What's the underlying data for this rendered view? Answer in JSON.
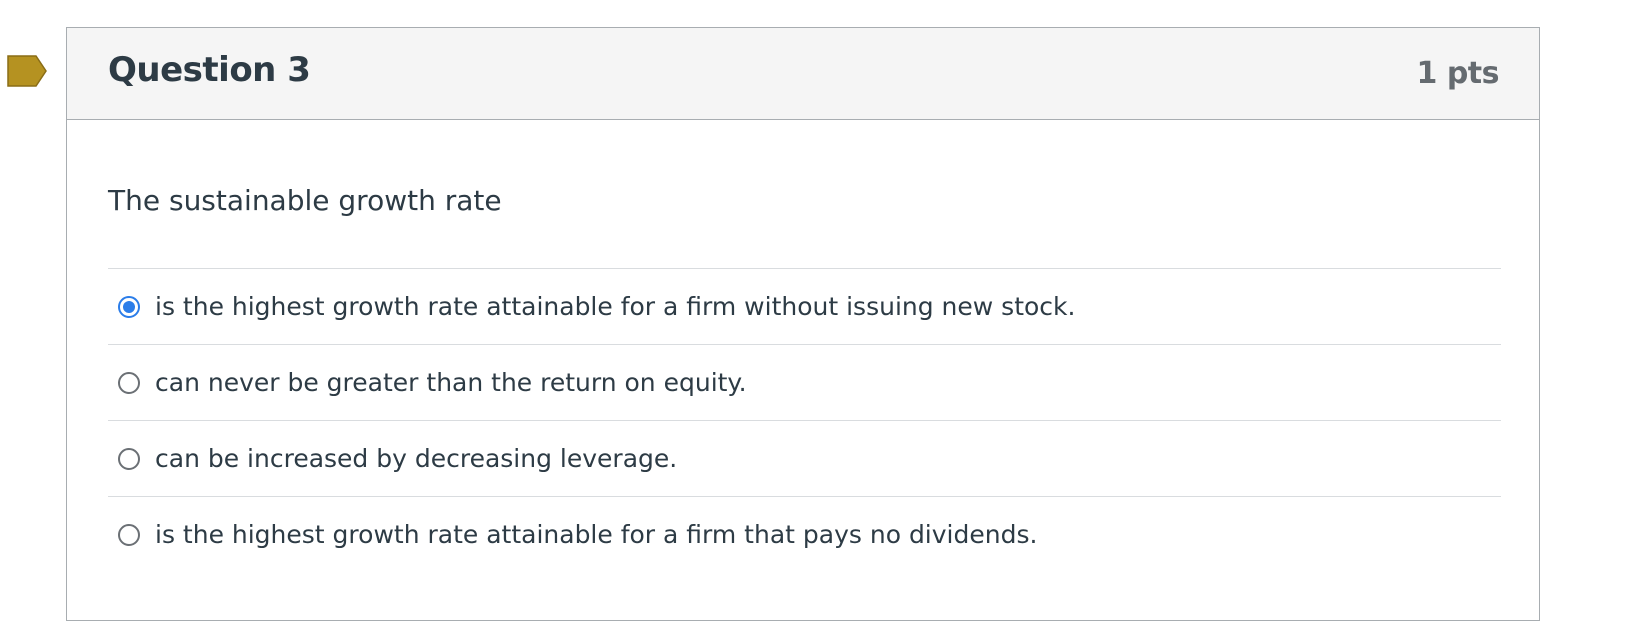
{
  "question": {
    "title": "Question 3",
    "points": "1 pts",
    "text": "The sustainable growth rate",
    "answers": [
      {
        "label": "is the highest growth rate attainable for a firm without issuing new stock.",
        "selected": true
      },
      {
        "label": "can never be greater than the return on equity.",
        "selected": false
      },
      {
        "label": "can be increased by decreasing leverage.",
        "selected": false
      },
      {
        "label": "is the highest growth rate attainable for a firm that pays no dividends.",
        "selected": false
      }
    ]
  },
  "colors": {
    "flag": "#b59221",
    "radio_selected": "#2b7de9",
    "header_bg": "#f5f5f5",
    "text": "#2d3b45"
  },
  "icons": {
    "flag": "bookmark-flag-icon"
  }
}
